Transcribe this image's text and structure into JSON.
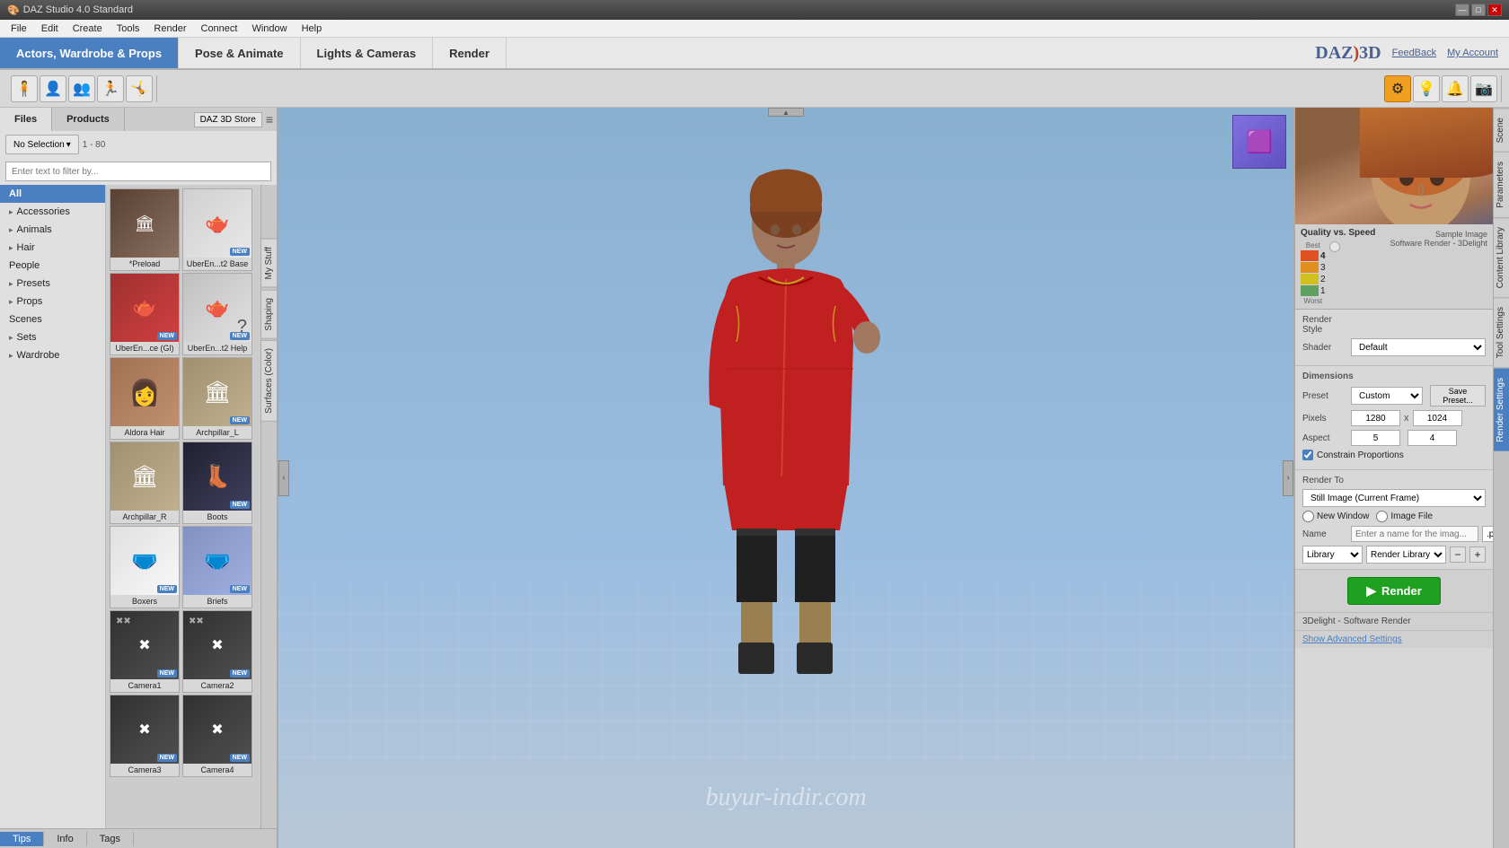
{
  "app": {
    "title": "DAZ Studio 4.0 Standard",
    "logo": "DAZ 3D"
  },
  "titlebar": {
    "title": "DAZ Studio 4.0 Standard",
    "minimize": "—",
    "maximize": "□",
    "close": "✕"
  },
  "menubar": {
    "items": [
      "File",
      "Edit",
      "Create",
      "Tools",
      "Render",
      "Connect",
      "Window",
      "Help"
    ]
  },
  "mainnav": {
    "tabs": [
      "Actors, Wardrobe & Props",
      "Pose & Animate",
      "Lights & Cameras",
      "Render"
    ]
  },
  "feedback": "FeedBack",
  "myaccount": "My Account",
  "left_panel": {
    "tabs": [
      "Files",
      "Products"
    ],
    "store_btn": "DAZ 3D Store",
    "count": "1 - 80",
    "filter_placeholder": "Enter text to filter by...",
    "selection_btn": "No Selection",
    "tree_items": [
      {
        "label": "All",
        "active": true
      },
      {
        "label": "Accessories"
      },
      {
        "label": "Animals"
      },
      {
        "label": "Hair"
      },
      {
        "label": "People",
        "active": false
      },
      {
        "label": "Presets"
      },
      {
        "label": "Props"
      },
      {
        "label": "Scenes"
      },
      {
        "label": "Sets"
      },
      {
        "label": "Wardrobe"
      }
    ],
    "thumbnails": [
      {
        "label": "*Preload",
        "has_new": false,
        "color": "#6a5040"
      },
      {
        "label": "UberEn...t2 Base",
        "has_new": true,
        "color": "#c8c8c8"
      },
      {
        "label": "UberEn...ce (Gl)",
        "has_new": true,
        "color": "#c04040"
      },
      {
        "label": "UberEn...t2 Help",
        "has_new": true,
        "color": "#c8c8c8"
      },
      {
        "label": "Aldora Hair",
        "has_new": false,
        "color": "#a07050"
      },
      {
        "label": "Archpillar_L",
        "has_new": true,
        "color": "#b0a080"
      },
      {
        "label": "Archpillar_R",
        "has_new": false,
        "color": "#b0a080"
      },
      {
        "label": "Boots",
        "has_new": true,
        "color": "#303050"
      },
      {
        "label": "Boxers",
        "has_new": true,
        "color": "#f0f0f0"
      },
      {
        "label": "Briefs",
        "has_new": true,
        "color": "#b0c0e0"
      },
      {
        "label": "Camera1",
        "has_new": true,
        "color": "#404040"
      },
      {
        "label": "Camera2",
        "has_new": true,
        "color": "#404040"
      },
      {
        "label": "Camera3",
        "has_new": true,
        "color": "#404040"
      },
      {
        "label": "Camera4",
        "has_new": true,
        "color": "#404040"
      }
    ]
  },
  "side_tabs": [
    "My Stuff",
    "Shaping",
    "Surfaces (Color)"
  ],
  "viewport": {
    "watermark": "buyur-indir.com"
  },
  "right_panel": {
    "vert_tabs": [
      "Scene",
      "Parameters",
      "Content Library",
      "Tool Settings",
      "Render Settings"
    ],
    "quality_label": "Quality vs. Speed",
    "quality_best": "Best",
    "quality_worst": "Worst",
    "quality_levels": [
      "4",
      "3",
      "2",
      "1"
    ],
    "quality_colors": [
      "#e05020",
      "#e09020",
      "#d0c020",
      "#60a060"
    ],
    "sample_image_label": "Sample Image",
    "render_engine": "Software Render - 3Delight",
    "render_style_label": "Render Style",
    "shader_label": "Shader",
    "shader_value": "Default",
    "dimensions_label": "Dimensions",
    "preset_label": "Preset",
    "preset_value": "Custom",
    "save_preset_btn": "Save Preset...",
    "pixels_label": "Pixels",
    "pixels_w": "1280",
    "pixels_x": "x",
    "pixels_h": "1024",
    "aspect_label": "Aspect",
    "aspect_w": "5",
    "aspect_h": "4",
    "constrain_label": "Constrain Proportions",
    "render_to_label": "Render To",
    "render_to_value": "Still Image (Current Frame)",
    "new_window_label": "New Window",
    "image_file_label": "Image File",
    "name_label": "Name",
    "name_placeholder": "Enter a name for the imag...",
    "format_value": ".png",
    "library_label": "Library",
    "render_library_label": "Render Library",
    "render_btn": "Render",
    "bottom_engine": "3Delight - Software Render",
    "show_advanced": "Show Advanced Settings"
  }
}
